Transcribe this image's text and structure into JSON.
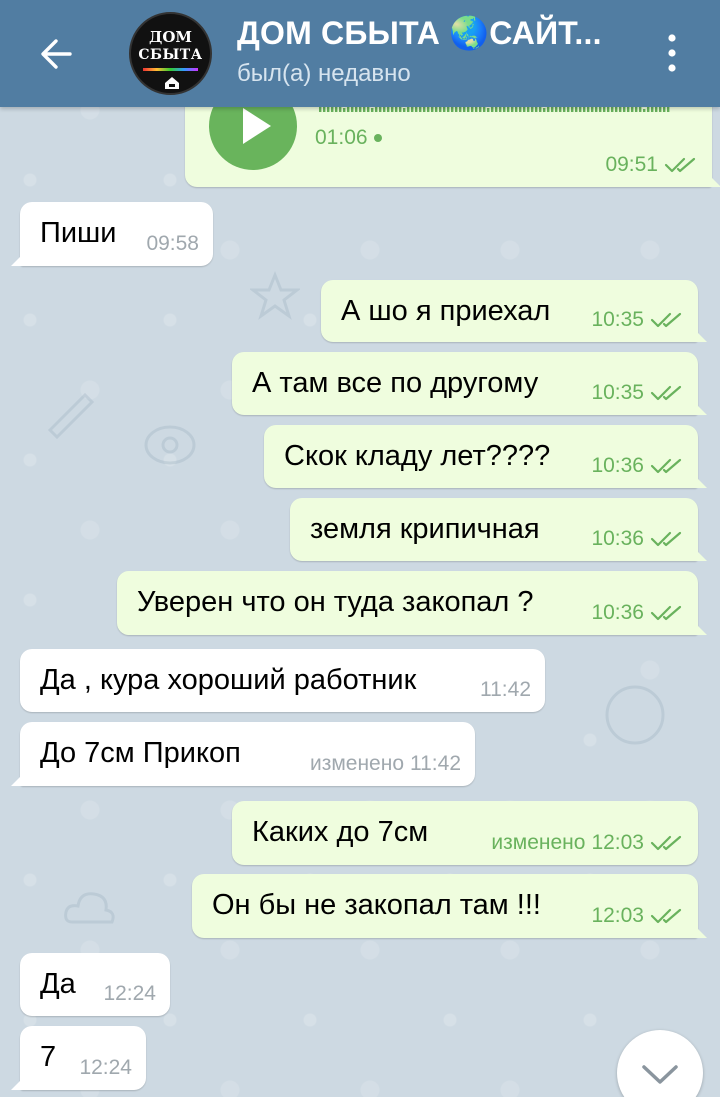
{
  "header": {
    "title": "ДОМ СБЫТА 🌏САЙТ...",
    "status": "был(а) недавно",
    "avatar_line1": "ДОМ",
    "avatar_line2": "СБЫТА",
    "back_icon": "arrow-left-icon",
    "menu_icon": "more-vertical-icon"
  },
  "voice_message": {
    "duration": "01:06",
    "time": "09:51",
    "play_icon": "play-icon"
  },
  "messages": [
    {
      "dir": "in",
      "text": "Пиши",
      "time": "09:58",
      "edited": ""
    },
    {
      "dir": "out",
      "text": "А шо я приехал",
      "time": "10:35",
      "edited": ""
    },
    {
      "dir": "out",
      "text": "А там все по другому",
      "time": "10:35",
      "edited": ""
    },
    {
      "dir": "out",
      "text": "Скок кладу лет????",
      "time": "10:36",
      "edited": ""
    },
    {
      "dir": "out",
      "text": "земля крипичная",
      "time": "10:36",
      "edited": ""
    },
    {
      "dir": "out",
      "text": "Уверен что он туда закопал ?",
      "time": "10:36",
      "edited": ""
    },
    {
      "dir": "in",
      "text": "Да , кура хороший работник",
      "time": "11:42",
      "edited": ""
    },
    {
      "dir": "in",
      "text": "До 7см Прикоп",
      "time": "11:42",
      "edited": "изменено"
    },
    {
      "dir": "out",
      "text": "Каких до 7см",
      "time": "12:03",
      "edited": "изменено"
    },
    {
      "dir": "out",
      "text": "Он бы не закопал там !!!",
      "time": "12:03",
      "edited": ""
    },
    {
      "dir": "in",
      "text": "Да",
      "time": "12:24",
      "edited": ""
    },
    {
      "dir": "in",
      "text": "7",
      "time": "12:24",
      "edited": ""
    }
  ],
  "scroll_down_icon": "chevron-down-icon",
  "colors": {
    "header": "#517da2",
    "outgoing": "#effdde",
    "incoming": "#ffffff",
    "accent_green": "#69b25d"
  }
}
